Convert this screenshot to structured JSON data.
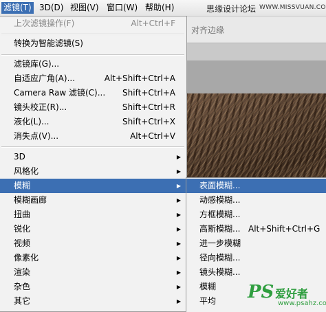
{
  "menubar": {
    "items": [
      {
        "label": "滤镜(T)",
        "active": true
      },
      {
        "label": "3D(D)",
        "active": false
      },
      {
        "label": "视图(V)",
        "active": false
      },
      {
        "label": "窗口(W)",
        "active": false
      },
      {
        "label": "帮助(H)",
        "active": false
      }
    ],
    "site_title": "思缘设计论坛",
    "site_url": "WWW.MISSVUAN.COM"
  },
  "background": {
    "options_text": "对齐边缘"
  },
  "filter_menu": {
    "items": [
      {
        "label": "上次滤镜操作(F)",
        "shortcut": "Alt+Ctrl+F",
        "disabled": true
      },
      {
        "label": "转换为智能滤镜(S)",
        "shortcut": ""
      },
      {
        "label": "滤镜库(G)...",
        "shortcut": ""
      },
      {
        "label": "自适应广角(A)...",
        "shortcut": "Alt+Shift+Ctrl+A"
      },
      {
        "label": "Camera Raw 滤镜(C)...",
        "shortcut": "Shift+Ctrl+A"
      },
      {
        "label": "镜头校正(R)...",
        "shortcut": "Shift+Ctrl+R"
      },
      {
        "label": "液化(L)...",
        "shortcut": "Shift+Ctrl+X"
      },
      {
        "label": "消失点(V)...",
        "shortcut": "Alt+Ctrl+V"
      },
      {
        "label": "3D",
        "submenu": true
      },
      {
        "label": "风格化",
        "submenu": true
      },
      {
        "label": "模糊",
        "submenu": true,
        "highlighted": true
      },
      {
        "label": "模糊画廊",
        "submenu": true
      },
      {
        "label": "扭曲",
        "submenu": true
      },
      {
        "label": "锐化",
        "submenu": true
      },
      {
        "label": "视频",
        "submenu": true
      },
      {
        "label": "像素化",
        "submenu": true
      },
      {
        "label": "渲染",
        "submenu": true
      },
      {
        "label": "杂色",
        "submenu": true
      },
      {
        "label": "其它",
        "submenu": true
      }
    ],
    "arrow_glyph": "▶"
  },
  "blur_submenu": {
    "items": [
      {
        "label": "表面模糊...",
        "shortcut": "",
        "highlighted": true
      },
      {
        "label": "动感模糊...",
        "shortcut": ""
      },
      {
        "label": "方框模糊...",
        "shortcut": ""
      },
      {
        "label": "高斯模糊...",
        "shortcut": "Alt+Shift+Ctrl+G"
      },
      {
        "label": "进一步模糊",
        "shortcut": ""
      },
      {
        "label": "径向模糊...",
        "shortcut": ""
      },
      {
        "label": "镜头模糊...",
        "shortcut": ""
      },
      {
        "label": "模糊",
        "shortcut": ""
      },
      {
        "label": "平均",
        "shortcut": ""
      }
    ]
  },
  "watermark": {
    "logo": "PS",
    "name": "爱好者",
    "url": "www.psahz.com"
  },
  "colors": {
    "highlight": "#3c6fb3",
    "menu_bg": "#f2f2f2",
    "watermark_green": "#2f9e3f"
  }
}
